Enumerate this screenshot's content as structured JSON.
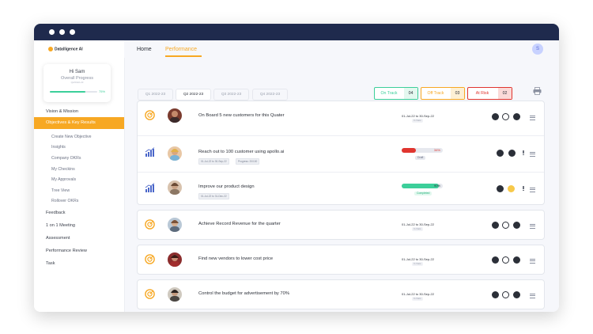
{
  "brand": {
    "name": "Datalligence AI"
  },
  "user": {
    "greeting": "Hi Sam",
    "progress_label": "Overall Progress",
    "progress_sub": "Q2/2022-23",
    "progress_value": "75%",
    "progress_fraction": 0.75,
    "avatar_initial": "S"
  },
  "topnav": {
    "home": "Home",
    "performance": "Performance"
  },
  "sidebar": {
    "items": [
      {
        "label": "Vision & Mission"
      },
      {
        "label": "Objectives & Key Results"
      },
      {
        "label": "Create New Objective"
      },
      {
        "label": "Insights"
      },
      {
        "label": "Company OKRs"
      },
      {
        "label": "My  Checkins"
      },
      {
        "label": "My Approvals"
      },
      {
        "label": "Tree View"
      },
      {
        "label": "Rollover OKRs"
      },
      {
        "label": "Feedback"
      },
      {
        "label": "1 on 1 Meeting"
      },
      {
        "label": "Assessment"
      },
      {
        "label": "Performance Review"
      },
      {
        "label": "Task"
      }
    ]
  },
  "quarters": [
    "Q1 2022-23",
    "Q2 2022-23",
    "Q3 2022-23",
    "Q4 2022-23"
  ],
  "status_summary": [
    {
      "label": "On Track",
      "count": "04",
      "color": "#3ccf9a",
      "bg": "#e3f8ef"
    },
    {
      "label": "Off Track",
      "count": "03",
      "color": "#f7a823",
      "bg": "#fdf0d4"
    },
    {
      "label": "At Risk",
      "count": "02",
      "color": "#e0352f",
      "bg": "#fbdad8"
    }
  ],
  "objectives": [
    {
      "title": "On Board 5 new customers for this Quater",
      "dates": "01-Jul-22 to 30-Sep-22",
      "sub": "0 chats"
    },
    {
      "title": "Reach out to 100 customer using apollo.ai",
      "chips": [
        "01-Jul-22 to 30-Sep-22",
        "Progress: 20/100"
      ],
      "progress_label": "34%",
      "progress": 0.34,
      "bar_color": "#e0352f",
      "status": "Draft"
    },
    {
      "title": "Improve our product design",
      "chips": [
        "01-Jul-22 to 31-Dec-22"
      ],
      "progress_label": "90%",
      "progress": 0.9,
      "bar_color": "#3ccf9a",
      "status": "Completed"
    },
    {
      "title": "Achieve Record Revenue for the quarter",
      "dates": "01-Jul-22 to 30-Sep-22",
      "sub": "0 chats"
    },
    {
      "title": "Find new vendors to lower cost price",
      "dates": "01-Jul-22 to 30-Sep-22",
      "sub": "0 chats"
    },
    {
      "title": "Control the budget for advertisement by 70%",
      "dates": "01-Jul-22 to 30-Sep-22",
      "sub": "0 chats"
    }
  ]
}
